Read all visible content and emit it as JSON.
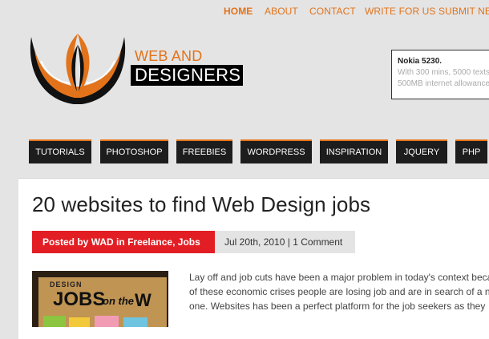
{
  "topnav": {
    "home": "HOME",
    "about": "ABOUT",
    "contact": "CONTACT",
    "write_for_us": "WRITE FOR US",
    "submit_news": "SUBMIT NEWS"
  },
  "brand": {
    "line1": "WEB AND",
    "line2": "DESIGNERS"
  },
  "ad": {
    "title": "Nokia 5230.",
    "line1": "With 300 mins, 5000 texts",
    "line2": "500MB internet allowance"
  },
  "mainnav": {
    "tutorials": "TUTORIALS",
    "photoshop": "PHOTOSHOP",
    "freebies": "FREEBIES",
    "wordpress": "WORDPRESS",
    "inspiration": "INSPIRATION",
    "jquery": "JQUERY",
    "php": "PHP"
  },
  "post": {
    "title": "20 websites to find Web Design jobs",
    "posted_by_prefix": "Posted by",
    "author": "WAD",
    "in_word": "in",
    "categories": "Freelance, Jobs",
    "date": "Jul 20th, 2010",
    "separator": "|",
    "comments": "1 Comment",
    "body_lines": [
      "Lay off and job cuts have been a major problem in today's context because",
      "of these economic crises people are losing job and are in search of a new",
      "one. Websites has been a perfect platform for the job seekers as they"
    ]
  },
  "thumbnail": {
    "small": "DESIGN",
    "big": "JOBS",
    "mid": "on the",
    "end": "W"
  },
  "colors": {
    "accent": "#e2731a",
    "nav_bg": "#1d1d1d",
    "meta_red": "#e21e24",
    "page_bg": "#e4e4e4"
  }
}
